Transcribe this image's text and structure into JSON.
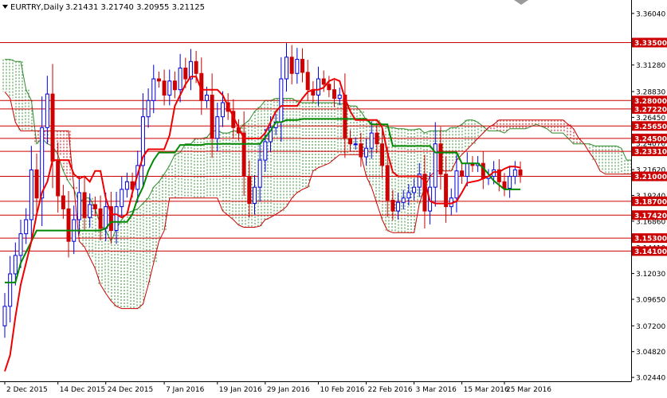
{
  "header": {
    "symbol_label": "EURTRY,Daily",
    "ohlc_values": "3.21431 3.21740 3.20955 3.21125"
  },
  "colors": {
    "background": "#ffffff",
    "frame": "#000000",
    "bull_candle": "#0000dd",
    "bear_candle": "#cc0000",
    "tenkan_line": "#ee0000",
    "kijun_line": "#008800",
    "cloud_bull_hatch": "#2e8b2e",
    "cloud_bear_hatch": "#cc0000",
    "support_resistance_line": "#cc0000",
    "level_tag_fill": "#cc0000",
    "level_tag_text": "#ffffff"
  },
  "chart_data": {
    "type": "candlestick",
    "title": "",
    "ylim": [
      3.0208,
      3.3728
    ],
    "y_ticks": [
      "3.36040",
      "3.33350",
      "3.31280",
      "3.28830",
      "3.26450",
      "3.24070",
      "3.21620",
      "3.19240",
      "3.16860",
      "3.14410",
      "3.12030",
      "3.09650",
      "3.07200",
      "3.04820",
      "3.02440"
    ],
    "x_tick_labels": [
      "2 Dec 2015",
      "14 Dec 2015",
      "24 Dec 2015",
      "7 Jan 2016",
      "19 Jan 2016",
      "29 Jan 2016",
      "10 Feb 2016",
      "22 Feb 2016",
      "3 Mar 2016",
      "15 Mar 2016",
      "25 Mar 2016"
    ],
    "x_tick_positions": [
      0,
      10,
      19,
      30,
      40,
      49,
      59,
      68,
      77,
      86,
      94
    ],
    "horizontal_levels": [
      {
        "value": 3.3335,
        "label": "3.33500"
      },
      {
        "value": 3.28,
        "label": "3.28000"
      },
      {
        "value": 3.2722,
        "label": "3.27220"
      },
      {
        "value": 3.2565,
        "label": "3.25650"
      },
      {
        "value": 3.245,
        "label": "3.24500"
      },
      {
        "value": 3.2331,
        "label": "3.23310"
      },
      {
        "value": 3.21,
        "label": "3.21000"
      },
      {
        "value": 3.187,
        "label": "3.18700"
      },
      {
        "value": 3.1742,
        "label": "3.17420"
      },
      {
        "value": 3.153,
        "label": "3.15300"
      },
      {
        "value": 3.141,
        "label": "3.14100"
      }
    ],
    "candles": {
      "open": [
        3.072,
        3.09,
        3.12,
        3.137,
        3.157,
        3.17,
        3.216,
        3.19,
        3.255,
        3.286,
        3.224,
        3.192,
        3.18,
        3.15,
        3.17,
        3.195,
        3.172,
        3.184,
        3.18,
        3.162,
        3.182,
        3.16,
        3.182,
        3.198,
        3.205,
        3.198,
        3.22,
        3.265,
        3.28,
        3.3,
        3.298,
        3.285,
        3.298,
        3.29,
        3.31,
        3.3,
        3.316,
        3.305,
        3.28,
        3.285,
        3.245,
        3.265,
        3.278,
        3.27,
        3.255,
        3.25,
        3.21,
        3.185,
        3.2,
        3.225,
        3.242,
        3.255,
        3.26,
        3.3,
        3.32,
        3.305,
        3.318,
        3.306,
        3.29,
        3.285,
        3.3,
        3.295,
        3.29,
        3.282,
        3.285,
        3.245,
        3.24,
        3.24,
        3.228,
        3.236,
        3.25,
        3.24,
        3.22,
        3.188,
        3.178,
        3.186,
        3.19,
        3.195,
        3.2,
        3.212,
        3.178,
        3.2,
        3.24,
        3.212,
        3.182,
        3.19,
        3.215,
        3.21,
        3.222,
        3.22,
        3.222,
        3.208,
        3.21,
        3.216,
        3.205,
        3.199,
        3.21,
        3.216
      ],
      "close": [
        3.09,
        3.12,
        3.137,
        3.157,
        3.17,
        3.216,
        3.19,
        3.255,
        3.286,
        3.224,
        3.192,
        3.18,
        3.15,
        3.17,
        3.195,
        3.172,
        3.184,
        3.18,
        3.162,
        3.182,
        3.16,
        3.182,
        3.198,
        3.205,
        3.198,
        3.22,
        3.265,
        3.28,
        3.3,
        3.298,
        3.285,
        3.298,
        3.29,
        3.31,
        3.3,
        3.316,
        3.305,
        3.28,
        3.285,
        3.245,
        3.265,
        3.278,
        3.27,
        3.255,
        3.25,
        3.21,
        3.185,
        3.2,
        3.225,
        3.242,
        3.255,
        3.26,
        3.3,
        3.32,
        3.305,
        3.318,
        3.306,
        3.29,
        3.285,
        3.3,
        3.295,
        3.29,
        3.282,
        3.285,
        3.245,
        3.24,
        3.24,
        3.228,
        3.236,
        3.25,
        3.24,
        3.22,
        3.188,
        3.178,
        3.186,
        3.19,
        3.195,
        3.2,
        3.212,
        3.178,
        3.2,
        3.24,
        3.212,
        3.182,
        3.19,
        3.215,
        3.21,
        3.222,
        3.22,
        3.222,
        3.208,
        3.21,
        3.216,
        3.205,
        3.199,
        3.21,
        3.216,
        3.211
      ]
    },
    "tenkan_sen": [
      3.03,
      3.045,
      3.08,
      3.11,
      3.13,
      3.15,
      3.175,
      3.195,
      3.205,
      3.225,
      3.225,
      3.225,
      3.225,
      3.212,
      3.208,
      3.21,
      3.205,
      3.215,
      3.215,
      3.19,
      3.175,
      3.175,
      3.172,
      3.175,
      3.195,
      3.212,
      3.228,
      3.235,
      3.235,
      3.235,
      3.235,
      3.248,
      3.275,
      3.285,
      3.295,
      3.302,
      3.302,
      3.29,
      3.29,
      3.29,
      3.29,
      3.285,
      3.275,
      3.265,
      3.255,
      3.245,
      3.245,
      3.245,
      3.245,
      3.25,
      3.26,
      3.27,
      3.275,
      3.275,
      3.275,
      3.275,
      3.282,
      3.288,
      3.29,
      3.29,
      3.292,
      3.298,
      3.3,
      3.298,
      3.282,
      3.27,
      3.262,
      3.262,
      3.262,
      3.262,
      3.262,
      3.255,
      3.232,
      3.214,
      3.21,
      3.21,
      3.21,
      3.21,
      3.21,
      3.206,
      3.187,
      3.185,
      3.185,
      3.185,
      3.185,
      3.187,
      3.195,
      3.204,
      3.205,
      3.206,
      3.208,
      3.21,
      3.214,
      3.214,
      3.217,
      3.219,
      3.219,
      3.218
    ],
    "kijun_sen": [
      3.112,
      3.112,
      3.112,
      3.13,
      3.14,
      3.15,
      3.16,
      3.16,
      3.16,
      3.16,
      3.16,
      3.16,
      3.16,
      3.16,
      3.16,
      3.16,
      3.16,
      3.16,
      3.16,
      3.162,
      3.168,
      3.168,
      3.168,
      3.168,
      3.175,
      3.19,
      3.2,
      3.215,
      3.225,
      3.232,
      3.232,
      3.232,
      3.232,
      3.239,
      3.239,
      3.239,
      3.239,
      3.239,
      3.24,
      3.24,
      3.24,
      3.24,
      3.24,
      3.24,
      3.24,
      3.24,
      3.24,
      3.24,
      3.24,
      3.246,
      3.252,
      3.26,
      3.26,
      3.262,
      3.262,
      3.262,
      3.263,
      3.263,
      3.263,
      3.263,
      3.263,
      3.263,
      3.263,
      3.263,
      3.263,
      3.263,
      3.263,
      3.263,
      3.263,
      3.258,
      3.258,
      3.258,
      3.258,
      3.238,
      3.238,
      3.238,
      3.238,
      3.238,
      3.238,
      3.238,
      3.238,
      3.232,
      3.232,
      3.232,
      3.232,
      3.232,
      3.222,
      3.222,
      3.222,
      3.222,
      3.218,
      3.212,
      3.206,
      3.202,
      3.198,
      3.198,
      3.198,
      3.198
    ],
    "cloud": {
      "start_index": 0,
      "span_a": [
        3.318,
        3.318,
        3.316,
        3.316,
        3.29,
        3.28,
        3.24,
        3.245,
        3.24,
        3.238,
        3.23,
        3.215,
        3.205,
        3.198,
        3.186,
        3.19,
        3.19,
        3.18,
        3.165,
        3.16,
        3.15,
        3.162,
        3.17,
        3.176,
        3.178,
        3.18,
        3.185,
        3.19,
        3.2,
        3.205,
        3.212,
        3.22,
        3.23,
        3.232,
        3.24,
        3.24,
        3.245,
        3.245,
        3.246,
        3.252,
        3.252,
        3.25,
        3.25,
        3.252,
        3.252,
        3.258,
        3.262,
        3.27,
        3.274,
        3.28,
        3.28,
        3.282,
        3.282,
        3.282,
        3.282,
        3.279,
        3.278,
        3.278,
        3.278,
        3.278,
        3.278,
        3.278,
        3.278,
        3.277,
        3.277,
        3.275,
        3.275,
        3.27,
        3.262,
        3.262,
        3.262,
        3.258,
        3.255,
        3.255,
        3.254,
        3.254,
        3.253,
        3.253,
        3.254,
        3.25,
        3.252,
        3.252,
        3.252,
        3.252,
        3.255,
        3.255,
        3.258,
        3.262,
        3.262,
        3.26,
        3.256,
        3.252,
        3.252,
        3.252,
        3.25,
        3.254,
        3.254,
        3.254,
        3.254,
        3.256,
        3.258,
        3.256,
        3.254,
        3.25,
        3.25,
        3.25,
        3.245,
        3.24,
        3.24,
        3.24,
        3.24,
        3.238,
        3.238,
        3.238,
        3.238,
        3.238,
        3.236,
        3.225,
        3.225
      ],
      "span_b": [
        3.288,
        3.282,
        3.26,
        3.252,
        3.252,
        3.252,
        3.252,
        3.252,
        3.252,
        3.252,
        3.252,
        3.252,
        3.252,
        3.2,
        3.15,
        3.145,
        3.135,
        3.125,
        3.11,
        3.102,
        3.095,
        3.09,
        3.088,
        3.088,
        3.088,
        3.088,
        3.092,
        3.11,
        3.13,
        3.15,
        3.16,
        3.19,
        3.19,
        3.19,
        3.19,
        3.19,
        3.19,
        3.19,
        3.19,
        3.19,
        3.19,
        3.178,
        3.174,
        3.17,
        3.165,
        3.163,
        3.163,
        3.163,
        3.164,
        3.17,
        3.172,
        3.175,
        3.178,
        3.182,
        3.19,
        3.195,
        3.198,
        3.2,
        3.215,
        3.218,
        3.22,
        3.222,
        3.226,
        3.23,
        3.23,
        3.23,
        3.23,
        3.23,
        3.21,
        3.2,
        3.185,
        3.17,
        3.16,
        3.158,
        3.158,
        3.158,
        3.158,
        3.158,
        3.185,
        3.2,
        3.21,
        3.215,
        3.215,
        3.215,
        3.215,
        3.225,
        3.23,
        3.235,
        3.24,
        3.245,
        3.25,
        3.255,
        3.258,
        3.262,
        3.262,
        3.262,
        3.262,
        3.262,
        3.262,
        3.262,
        3.262,
        3.262,
        3.262,
        3.262,
        3.262,
        3.262,
        3.258,
        3.254,
        3.245,
        3.24,
        3.232,
        3.225,
        3.215,
        3.212,
        3.212,
        3.212,
        3.212,
        3.212,
        3.212
      ]
    }
  }
}
